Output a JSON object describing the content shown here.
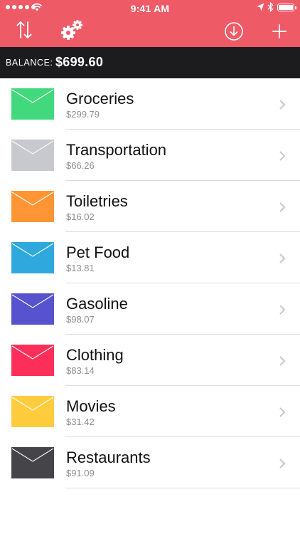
{
  "status_bar": {
    "time": "9:41 AM"
  },
  "toolbar": {
    "sort_icon": "sort-arrows-icon",
    "settings_icon": "gears-icon",
    "download_icon": "download-circle-icon",
    "add_icon": "plus-icon"
  },
  "balance": {
    "label": "BALANCE:",
    "value": "$699.60"
  },
  "envelopes": [
    {
      "name": "Groceries",
      "amount": "$299.79",
      "color": "#42d97c"
    },
    {
      "name": "Transportation",
      "amount": "$66.26",
      "color": "#c8c8cf"
    },
    {
      "name": "Toiletries",
      "amount": "$16.02",
      "color": "#ff9534"
    },
    {
      "name": "Pet Food",
      "amount": "$13.81",
      "color": "#2fa9dd"
    },
    {
      "name": "Gasoline",
      "amount": "$98.07",
      "color": "#5753ce"
    },
    {
      "name": "Clothing",
      "amount": "$83.14",
      "color": "#fb2f5a"
    },
    {
      "name": "Movies",
      "amount": "$31.42",
      "color": "#ffcc3e"
    },
    {
      "name": "Restaurants",
      "amount": "$91.09",
      "color": "#454549"
    }
  ],
  "colors": {
    "header": "#ee5b67",
    "balance_bar": "#1c1c1e"
  }
}
